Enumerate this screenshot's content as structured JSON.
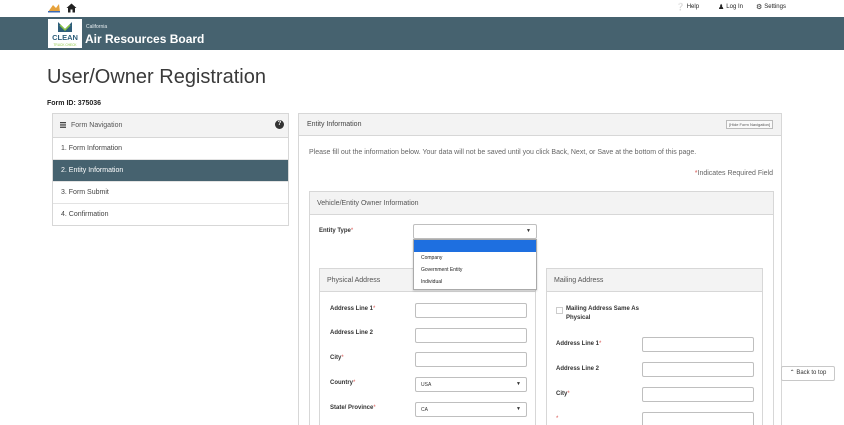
{
  "topbar": {
    "help_label": "Help",
    "login_label": "Log In",
    "settings_label": "Settings"
  },
  "header": {
    "logo_text_top": "CLEAN",
    "logo_text_bottom": "TRUCK CHECK",
    "state": "California",
    "agency": "Air Resources Board"
  },
  "page": {
    "title": "User/Owner Registration",
    "form_id": "Form ID: 375036"
  },
  "nav": {
    "title": "Form Navigation",
    "items": [
      {
        "label": "1. Form Information",
        "active": false
      },
      {
        "label": "2. Entity Information",
        "active": true
      },
      {
        "label": "3. Form Submit",
        "active": false
      },
      {
        "label": "4. Confirmation",
        "active": false
      }
    ]
  },
  "panel": {
    "title": "Entity Information",
    "hide_nav": "[Hide Form Navigation]",
    "intro": "Please fill out the information below. Your data will not be saved until you click Back, Next, or Save at the bottom of this page.",
    "required_note": "Indicates Required Field",
    "section_title": "Vehicle/Entity Owner Information"
  },
  "entity_type": {
    "label": "Entity Type",
    "value": "",
    "options": [
      "",
      "Company",
      "Government Entity",
      "Individual"
    ]
  },
  "physical": {
    "title": "Physical Address",
    "address1_label": "Address Line 1",
    "address2_label": "Address Line 2",
    "city_label": "City",
    "country_label": "Country",
    "country_value": "USA",
    "state_label": "State/ Province",
    "state_value": "CA"
  },
  "mailing": {
    "title": "Mailing Address",
    "same_label_1": "Mailing Address Same As",
    "same_label_2": "Physical",
    "address1_label": "Address Line 1",
    "address2_label": "Address Line 2",
    "city_label": "City"
  },
  "back_to_top": "Back to top",
  "colors": {
    "header": "#46626f",
    "active_nav": "#46626f",
    "required": "#d9534f",
    "dropdown_highlight": "#1e6fe0"
  }
}
